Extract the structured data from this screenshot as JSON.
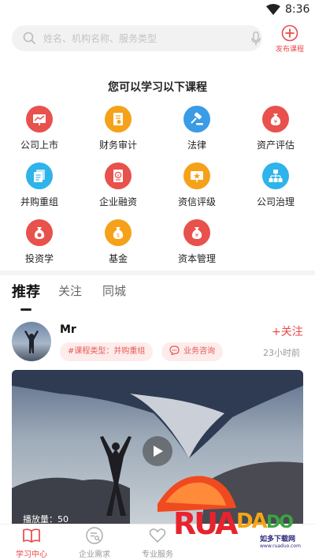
{
  "status_bar": {
    "time": "8:36"
  },
  "search": {
    "placeholder": "姓名、机构名称、服务类型"
  },
  "publish": {
    "label": "发布课程"
  },
  "section": {
    "title": "您可以学习以下课程"
  },
  "categories": [
    {
      "label": "公司上市",
      "icon": "chart-board-icon",
      "color": "#e8514c"
    },
    {
      "label": "财务审计",
      "icon": "document-icon",
      "color": "#f5a21a"
    },
    {
      "label": "法律",
      "icon": "gavel-icon",
      "color": "#3a9be6"
    },
    {
      "label": "资产评估",
      "icon": "money-bag-icon",
      "color": "#e8514c"
    },
    {
      "label": "并购重组",
      "icon": "documents-icon",
      "color": "#2eb3ea"
    },
    {
      "label": "企业融资",
      "icon": "finance-doc-icon",
      "color": "#e8514c"
    },
    {
      "label": "资信评级",
      "icon": "certificate-icon",
      "color": "#f5a21a"
    },
    {
      "label": "公司治理",
      "icon": "org-chart-icon",
      "color": "#2eb3ea"
    },
    {
      "label": "投资学",
      "icon": "coin-bag-icon",
      "color": "#e8514c"
    },
    {
      "label": "基金",
      "icon": "fund-bag-icon",
      "color": "#f5a21a"
    },
    {
      "label": "资本管理",
      "icon": "capital-bag-icon",
      "color": "#e8514c"
    }
  ],
  "tabs": [
    {
      "label": "推荐",
      "active": true
    },
    {
      "label": "关注",
      "active": false
    },
    {
      "label": "同城",
      "active": false
    }
  ],
  "post": {
    "author": "Mr",
    "tag_type": "#课程类型：并购重组",
    "tag_consult": "业务咨询",
    "follow_label": "+关注",
    "time": "23小时前",
    "play_count": "播放量：50"
  },
  "bottom_nav": [
    {
      "label": "学习中心",
      "icon": "book-icon",
      "active": true
    },
    {
      "label": "企业需求",
      "icon": "enterprise-icon",
      "active": false
    },
    {
      "label": "专业服务",
      "icon": "heart-icon",
      "active": false
    }
  ],
  "watermark": {
    "letters": "RUADADO",
    "sub": "如多下载网",
    "url": "www.ruaduo.com"
  },
  "colors": {
    "accent": "#e94a4a",
    "tag_bg": "#fdeceb"
  }
}
